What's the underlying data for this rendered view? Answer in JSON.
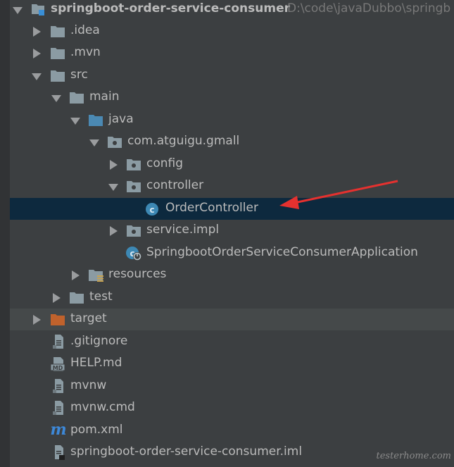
{
  "project": {
    "name": "springboot-order-service-consumer",
    "path": "D:\\code\\javaDubbo\\springb"
  },
  "tree": [
    {
      "label": ".idea",
      "icon": "folder-icon",
      "expanded": false
    },
    {
      "label": ".mvn",
      "icon": "folder-icon",
      "expanded": false
    },
    {
      "label": "src",
      "icon": "folder-icon",
      "expanded": true
    },
    {
      "label": "main",
      "icon": "folder-icon",
      "expanded": true
    },
    {
      "label": "java",
      "icon": "source-folder-icon",
      "expanded": true
    },
    {
      "label": "com.atguigu.gmall",
      "icon": "package-icon",
      "expanded": true
    },
    {
      "label": "config",
      "icon": "package-icon",
      "expanded": false
    },
    {
      "label": "controller",
      "icon": "package-icon",
      "expanded": true
    },
    {
      "label": "OrderController",
      "icon": "java-class-icon",
      "selected": true
    },
    {
      "label": "service.impl",
      "icon": "package-icon",
      "expanded": false
    },
    {
      "label": "SpringbootOrderServiceConsumerApplication",
      "icon": "spring-boot-class-icon"
    },
    {
      "label": "resources",
      "icon": "resources-folder-icon",
      "expanded": false
    },
    {
      "label": "test",
      "icon": "folder-icon",
      "expanded": false
    },
    {
      "label": "target",
      "icon": "excluded-folder-icon",
      "expanded": false
    },
    {
      "label": ".gitignore",
      "icon": "text-file-icon"
    },
    {
      "label": "HELP.md",
      "icon": "markdown-file-icon"
    },
    {
      "label": "mvnw",
      "icon": "text-file-icon"
    },
    {
      "label": "mvnw.cmd",
      "icon": "text-file-icon"
    },
    {
      "label": "pom.xml",
      "icon": "maven-file-icon"
    },
    {
      "label": "springboot-order-service-consumer.iml",
      "icon": "iml-file-icon"
    }
  ],
  "watermark": "testerhome.com",
  "colors": {
    "background": "#3c3f41",
    "selection": "#0d293e",
    "folder": "#8b9ba3",
    "source_folder": "#4b89b3",
    "excluded_folder": "#c0622c",
    "annotation_arrow": "#e5312f"
  }
}
